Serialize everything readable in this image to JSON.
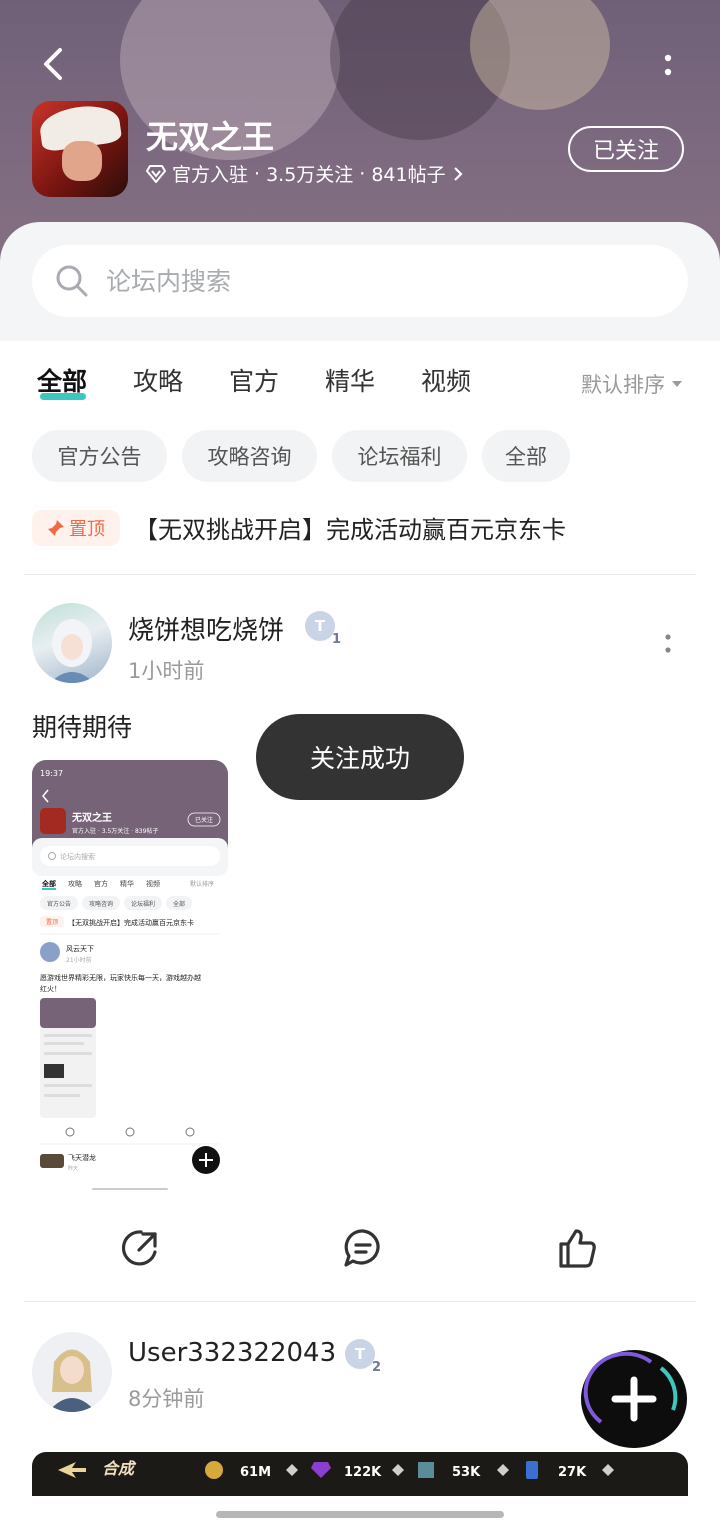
{
  "header": {
    "game_title": "无双之王",
    "verified_label": "官方入驻",
    "follower_count": "3.5万关注",
    "post_count": "841帖子",
    "follow_button": "已关注"
  },
  "search": {
    "placeholder": "论坛内搜索"
  },
  "tabs": [
    {
      "label": "全部",
      "active": true
    },
    {
      "label": "攻略",
      "active": false
    },
    {
      "label": "官方",
      "active": false
    },
    {
      "label": "精华",
      "active": false
    },
    {
      "label": "视频",
      "active": false
    }
  ],
  "sort_label": "默认排序",
  "chips": [
    "官方公告",
    "攻略咨询",
    "论坛福利",
    "全部"
  ],
  "pinned": {
    "badge": "置顶",
    "title": "【无双挑战开启】完成活动赢百元京东卡"
  },
  "posts": [
    {
      "username": "烧饼想吃烧饼",
      "level": "1",
      "time": "1小时前",
      "body": "期待期待"
    },
    {
      "username": "User332322043",
      "level": "2",
      "time": "8分钟前"
    }
  ],
  "thumbnail": {
    "status_time": "19:37",
    "title": "无双之王",
    "meta": "官方入驻 · 3.5万关注 · 839帖子",
    "follow": "已关注",
    "search": "论坛内搜索",
    "tabs": [
      "全部",
      "攻略",
      "官方",
      "精华",
      "视频"
    ],
    "sort": "默认排序",
    "chips": [
      "官方公告",
      "攻略咨询",
      "论坛福利",
      "全部"
    ],
    "pinned_badge": "置顶",
    "pinned_title": "【无双挑战开启】完成活动赢百元京东卡",
    "post1_user": "风云天下",
    "post1_time": "21小时前",
    "post1_body": "愿游戏世界精彩无限，玩家快乐每一天，游戏越办越红火！",
    "post2_user": "飞天潜龙",
    "post2_time": "昨天"
  },
  "toast": "关注成功",
  "game_strip": {
    "title": "合成",
    "gold": "61M",
    "gems": "122K",
    "cubes": "53K",
    "cards": "27K"
  },
  "colors": {
    "accent": "#3cc7c0",
    "pin": "#ef6a47",
    "hero": "#7d6a80"
  }
}
